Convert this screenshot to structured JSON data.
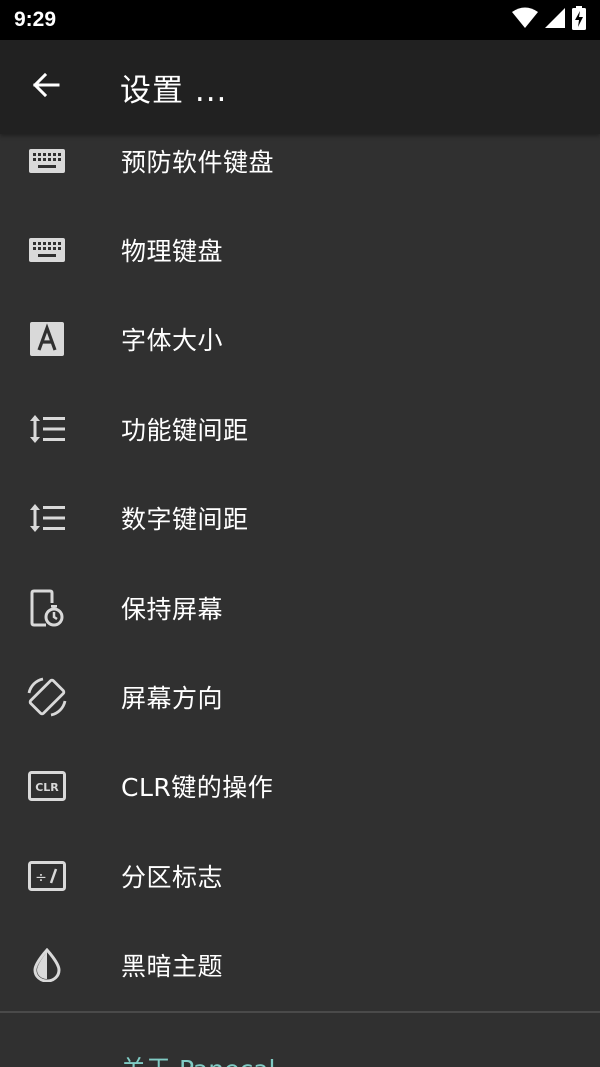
{
  "status_bar": {
    "time": "9:29"
  },
  "app_bar": {
    "title": "设置 ..."
  },
  "settings": {
    "items": [
      {
        "label": "预防软件键盘",
        "icon": "keyboard-icon"
      },
      {
        "label": "物理键盘",
        "icon": "keyboard-icon"
      },
      {
        "label": "字体大小",
        "icon": "font-size-icon"
      },
      {
        "label": "功能键间距",
        "icon": "line-spacing-icon"
      },
      {
        "label": "数字键间距",
        "icon": "line-spacing-icon"
      },
      {
        "label": "保持屏幕",
        "icon": "screen-timer-icon"
      },
      {
        "label": "屏幕方向",
        "icon": "screen-rotation-icon"
      },
      {
        "label": "CLR键的操作",
        "icon": "clr-icon"
      },
      {
        "label": "分区标志",
        "icon": "divide-icon"
      },
      {
        "label": "黑暗主题",
        "icon": "contrast-icon"
      }
    ],
    "about_label": "关于 Panecal"
  },
  "colors": {
    "status_bar_bg": "#000000",
    "app_bar_bg": "#212121",
    "list_bg": "#303030",
    "icon_color": "#d9d9d9",
    "accent": "#80cbc4"
  }
}
